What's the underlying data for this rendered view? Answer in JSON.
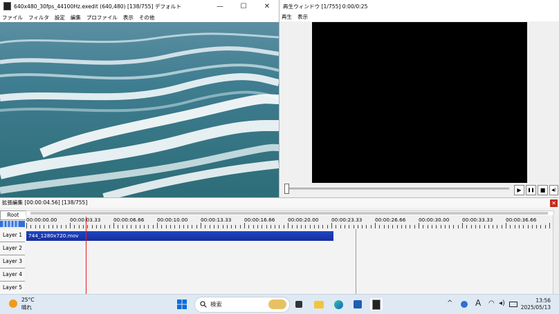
{
  "main_window": {
    "title": "640x480_30fps_44100Hz.exedit (640,480)  [138/755]  デフォルト",
    "menu": [
      "ファイル",
      "フィルタ",
      "設定",
      "編集",
      "プロファイル",
      "表示",
      "その他"
    ],
    "controls": {
      "minimize": "—",
      "maximize": "☐",
      "close": "✕"
    }
  },
  "playback_window": {
    "title": "再生ウィンドウ  [1/755]  0:00/0:25",
    "menu": [
      "再生",
      "表示"
    ],
    "buttons": {
      "play": "▶",
      "pause": "❚❚",
      "stop": "■",
      "audio": "◀)"
    }
  },
  "timeline": {
    "title": "拡張編集 [00:00:04.56] [138/755]",
    "close": "✕",
    "root": "Root",
    "ruler": [
      "00:00:00.00",
      "00:00:03.33",
      "00:00:06.66",
      "00:00:10.00",
      "00:00:13.33",
      "00:00:16.66",
      "00:00:20.00",
      "00:00:23.33",
      "00:00:26.66",
      "00:00:30.00",
      "00:00:33.33",
      "00:00:36.66"
    ],
    "layers": [
      "Layer 1",
      "Layer 2",
      "Layer 3",
      "Layer 4",
      "Layer 5"
    ],
    "clip": {
      "label": "744_1280x720.mov",
      "color": "#1634a8"
    }
  },
  "taskbar": {
    "weather": {
      "temp": "25°C",
      "cond": "晴れ"
    },
    "search_placeholder": "検索",
    "tray_ime": "A",
    "time": "13:56",
    "date": "2025/05/13"
  }
}
